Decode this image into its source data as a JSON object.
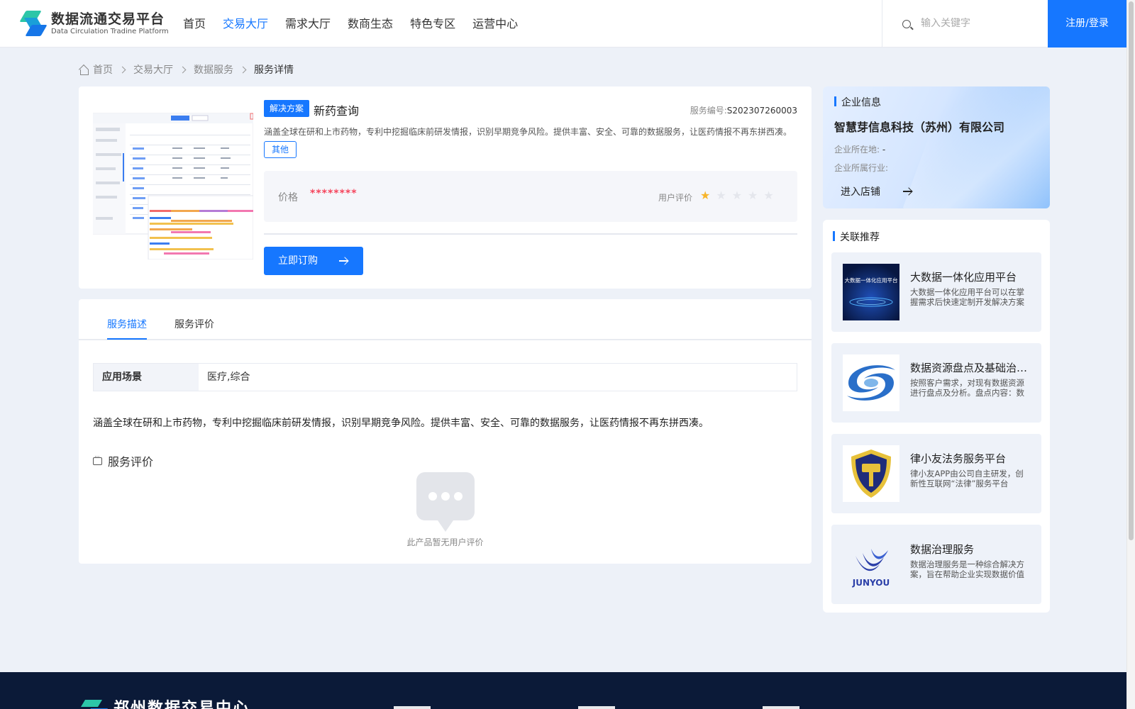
{
  "header": {
    "logo_cn": "数据流通交易平台",
    "logo_en": "Data Circulation Tradine Platform",
    "nav": [
      "首页",
      "交易大厅",
      "需求大厅",
      "数商生态",
      "特色专区",
      "运营中心"
    ],
    "active_nav": "交易大厅",
    "search_placeholder": "输入关键字",
    "login": "注册/登录"
  },
  "breadcrumb": [
    "首页",
    "交易大厅",
    "数据服务",
    "服务详情"
  ],
  "product": {
    "tag": "解决方案",
    "title": "新药查询",
    "service_no_label": "服务编号:",
    "service_no": "S202307260003",
    "description": "涵盖全球在研和上市药物，专利中挖掘临床前研发情报，识别早期竞争风险。提供丰富、安全、可靠的数据服务，让医药情报不再东拼西凑。",
    "category": "其他",
    "price_label": "价格",
    "price": "********",
    "rating_label": "用户评价",
    "rating": 1,
    "rating_max": 5,
    "buy_label": "立即订购"
  },
  "tabs": [
    "服务描述",
    "服务评价"
  ],
  "active_tab": "服务描述",
  "detail": {
    "scene_label": "应用场景",
    "scene_value": "医疗,综合",
    "long_description": "涵盖全球在研和上市药物，专利中挖掘临床前研发情报，识别早期竞争风险。提供丰富、安全、可靠的数据服务，让医药情报不再东拼西凑。",
    "review_title": "服务评价",
    "empty_review": "此产品暂无用户评价"
  },
  "company": {
    "section_title": "企业信息",
    "name": "智慧芽信息科技（苏州）有限公司",
    "location_label": "企业所在地:",
    "location": "-",
    "industry_label": "企业所属行业:",
    "industry": "",
    "enter_store": "进入店铺"
  },
  "related": {
    "section_title": "关联推荐",
    "items": [
      {
        "title": "大数据一体化应用平台",
        "desc": "大数据一体化应用平台可以在掌握需求后快速定制开发解决方案",
        "image_icon": "big-data-platform-image",
        "image_text": "大数据一体化应用平台"
      },
      {
        "title": "数据资源盘点及基础治理服务",
        "desc": "按照客户需求，对现有数据资源进行盘点及分析。盘点内容：数据资源情况",
        "image_icon": "data-resource-logo"
      },
      {
        "title": "律小友法务服务平台",
        "desc": "律小友APP由公司自主研发，创新性互联网“法律”服务平台",
        "image_icon": "law-shield-logo"
      },
      {
        "title": "数据治理服务",
        "desc": "数据治理服务是一种综合解决方案，旨在帮助企业实现数据价值",
        "image_icon": "junyou-logo",
        "image_text": "JUNYOU"
      }
    ]
  },
  "footer": {
    "name": "郑州数据交易中心"
  },
  "colors": {
    "primary": "#1677ff",
    "price": "#f5455c",
    "star_on": "#f7b52b",
    "footer_bg": "#0b1a38"
  }
}
